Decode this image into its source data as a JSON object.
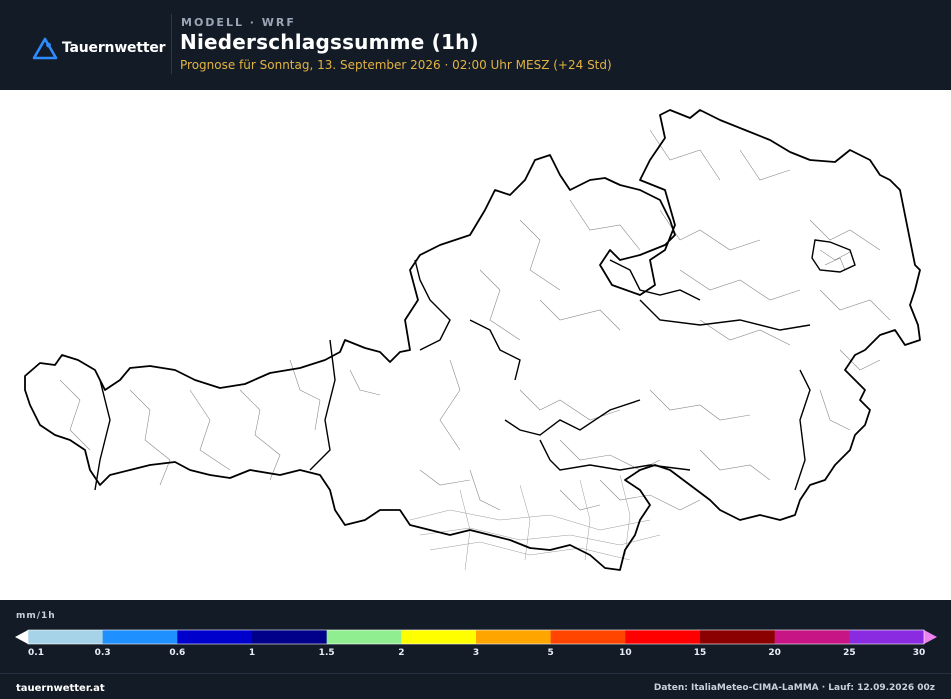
{
  "header": {
    "brand": "Tauernwetter",
    "model": "MODELL · WRF",
    "title": "Niederschlagssumme (1h)",
    "subtitle": "Prognose für Sonntag, 13. September 2026 · 02:00 Uhr MESZ  (+24 Std)"
  },
  "legend": {
    "unit": "mm/1h",
    "ticks": [
      "0.1",
      "0.3",
      "0.6",
      "1",
      "1.5",
      "2",
      "3",
      "5",
      "10",
      "15",
      "20",
      "25",
      "30"
    ],
    "colors": [
      "#a6d3e8",
      "#1e90ff",
      "#0000cd",
      "#00008b",
      "#90ee90",
      "#ffff00",
      "#ffa500",
      "#ff4500",
      "#ff0000",
      "#8b0000",
      "#c71585",
      "#8a2be2"
    ],
    "under_color": "#ffffff",
    "over_color": "#ee82ee"
  },
  "footer": {
    "site": "tauernwetter.at",
    "source": "Daten: ItaliaMeteo-CIMA-LaMMA · Lauf: 12.09.2026 00z"
  },
  "colors": {
    "background": "#131b27",
    "accent": "#e3b341",
    "logo": "#2f8cff"
  },
  "icons": {
    "logo": "mountain-logo-icon"
  }
}
